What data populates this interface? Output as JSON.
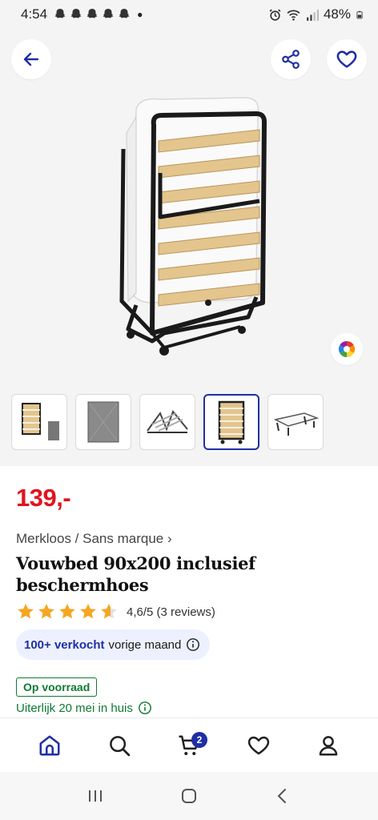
{
  "status": {
    "time": "4:54",
    "battery": "48%"
  },
  "product": {
    "price": "139,-",
    "brand": "Merkloos / Sans marque",
    "title": "Vouwbed 90x200 inclusief beschermhoes",
    "rating_value": 4.6,
    "rating_text": "4,6/5 (3 reviews)",
    "sold_highlight": "100+ verkocht",
    "sold_rest": "vorige maand",
    "stock": "Op voorraad",
    "delivery": "Uiterlijk 20 mei in huis"
  },
  "thumbnails": [
    {
      "name": "thumb-bed-with-cover",
      "active": false
    },
    {
      "name": "thumb-cover",
      "active": false
    },
    {
      "name": "thumb-frame",
      "active": false
    },
    {
      "name": "thumb-folded-bed",
      "active": true
    },
    {
      "name": "thumb-unfolded-bed",
      "active": false
    }
  ],
  "nav": {
    "cart_count": "2"
  },
  "colors": {
    "price": "#e0141e",
    "brand_blue": "#1f2fa3",
    "stock_green": "#0e7a33",
    "star": "#f5a623"
  }
}
